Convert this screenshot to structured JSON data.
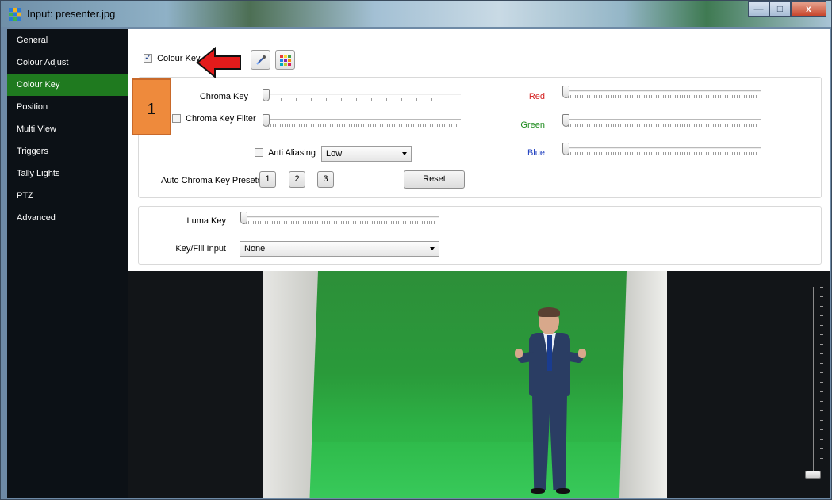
{
  "window": {
    "title": "Input: presenter.jpg",
    "icon": "app-grid-icon",
    "controls": [
      "minimize-icon",
      "maximize-icon",
      "close-icon"
    ],
    "close_glyph": "x"
  },
  "sidebar": {
    "items": [
      {
        "label": "General",
        "active": false
      },
      {
        "label": "Colour Adjust",
        "active": false
      },
      {
        "label": "Colour Key",
        "active": true
      },
      {
        "label": "Position",
        "active": false
      },
      {
        "label": "Multi View",
        "active": false
      },
      {
        "label": "Triggers",
        "active": false
      },
      {
        "label": "Tally Lights",
        "active": false
      },
      {
        "label": "PTZ",
        "active": false
      },
      {
        "label": "Advanced",
        "active": false
      }
    ],
    "active_color": "#1f7a1f"
  },
  "colour_key": {
    "enable_label": "Colour Key",
    "enabled": true,
    "eyedropper_icon": "eyedropper-icon",
    "palette_icon": "color-palette-icon",
    "chroma_key_label": "Chroma Key",
    "chroma_key_value": 0,
    "chroma_key_filter_label": "Chroma Key Filter",
    "chroma_key_filter_checked": false,
    "chroma_key_filter_value": 0,
    "anti_aliasing_label": "Anti Aliasing",
    "anti_aliasing_checked": false,
    "anti_aliasing_level": "Low",
    "presets_label": "Auto Chroma Key Presets",
    "presets": [
      "1",
      "2",
      "3"
    ],
    "reset_label": "Reset",
    "red_label": "Red",
    "red_color": "#d42020",
    "red_value": 0,
    "green_label": "Green",
    "green_color": "#1c8a1c",
    "green_value": 0,
    "blue_label": "Blue",
    "blue_color": "#1f3fbf",
    "blue_value": 0
  },
  "luma_key": {
    "label": "Luma Key",
    "value": 0,
    "fill_input_label": "Key/Fill Input",
    "fill_input_value": "None"
  },
  "annotation": {
    "badge_text": "1",
    "badge_color": "#ee8a3c",
    "arrow_color": "#e31b1b"
  },
  "preview": {
    "subject": "presenter-on-green-screen"
  }
}
